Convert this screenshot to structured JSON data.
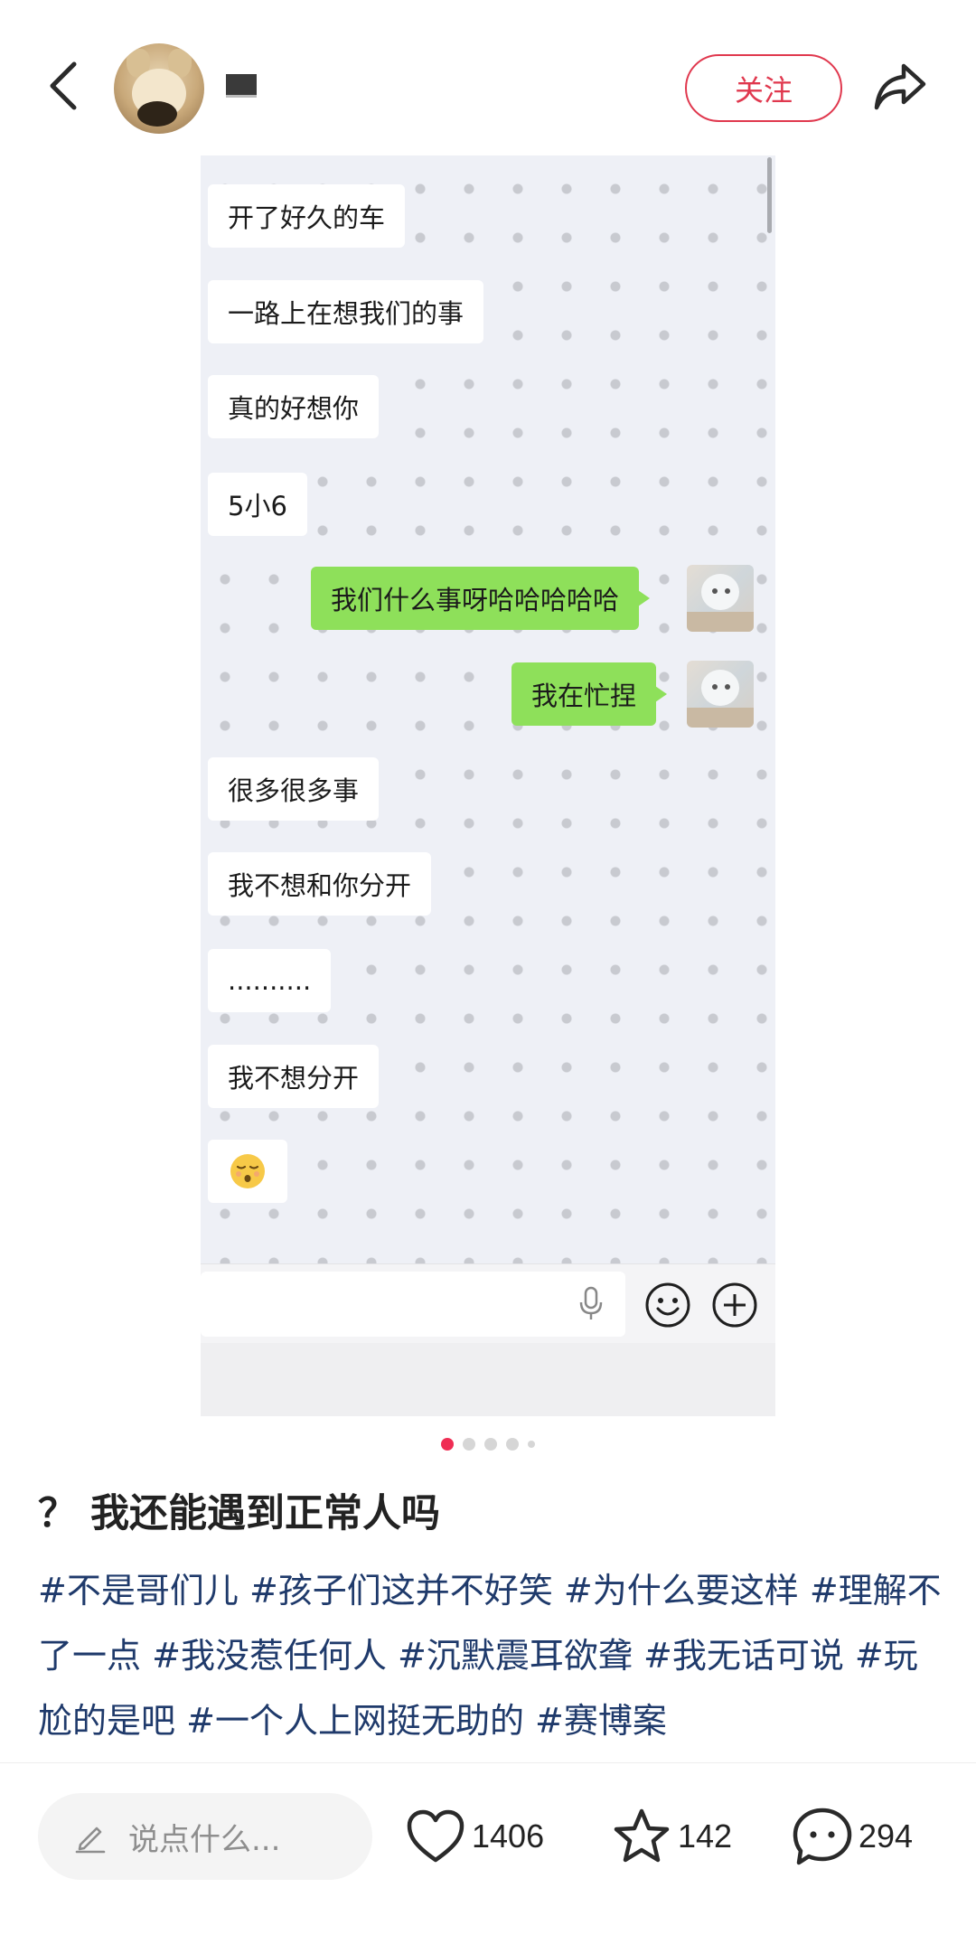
{
  "header": {
    "back_icon": "chevron-left-icon",
    "avatar_icon": "plush-avatar",
    "follow_label": "关注",
    "share_icon": "share-arrow-icon",
    "accent_color": "#e0384e"
  },
  "chat": {
    "messages": [
      {
        "side": "left",
        "text": "开了好久的车"
      },
      {
        "side": "left",
        "text": "一路上在想我们的事"
      },
      {
        "side": "left",
        "text": "真的好想你"
      },
      {
        "side": "left",
        "text": "5小6"
      },
      {
        "side": "right",
        "text": "我们什么事呀哈哈哈哈哈"
      },
      {
        "side": "right",
        "text": "我在忙捏"
      },
      {
        "side": "left",
        "text": "很多很多事"
      },
      {
        "side": "left",
        "text": "我不想和你分开"
      },
      {
        "side": "left",
        "text": ".........."
      },
      {
        "side": "left",
        "text": "我不想分开"
      },
      {
        "side": "left",
        "text": "😮‍💨"
      }
    ],
    "bubble_color_right": "#8ee05a",
    "input_icons": [
      "microphone-icon",
      "smile-icon",
      "plus-circle-icon"
    ]
  },
  "pager": {
    "count": 5,
    "active_index": 0
  },
  "post": {
    "title": "？ 我还能遇到正常人吗",
    "tags": [
      "#不是哥们儿",
      "#孩子们这并不好笑",
      "#为什么要这样",
      "#理解不了一点",
      "#我没惹任何人",
      "#沉默震耳欲聋",
      "#我无话可说",
      "#玩尬的是吧",
      "#一个人上网挺无助的",
      "#赛博案"
    ]
  },
  "bottom": {
    "comment_placeholder": "说点什么...",
    "likes": "1406",
    "stars": "142",
    "comments": "294"
  }
}
